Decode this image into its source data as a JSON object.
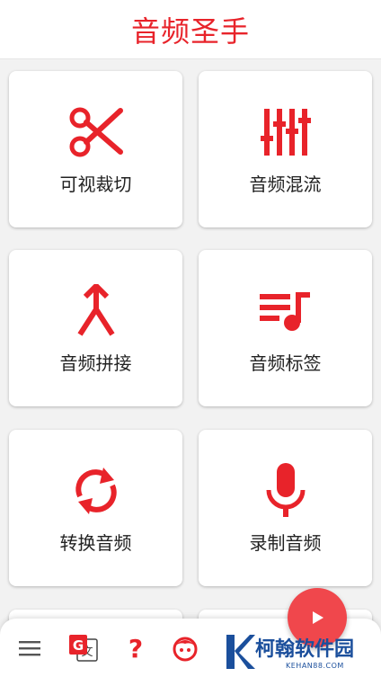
{
  "header": {
    "title": "音频圣手"
  },
  "tools": [
    {
      "label": "可视裁切",
      "icon": "scissors-icon"
    },
    {
      "label": "音频混流",
      "icon": "equalizer-icon"
    },
    {
      "label": "音频拼接",
      "icon": "merge-icon"
    },
    {
      "label": "音频标签",
      "icon": "playlist-music-icon"
    },
    {
      "label": "转换音频",
      "icon": "convert-cycle-icon"
    },
    {
      "label": "录制音频",
      "icon": "microphone-icon"
    }
  ],
  "bottom_nav": [
    {
      "icon": "menu-icon"
    },
    {
      "icon": "translate-icon"
    },
    {
      "icon": "help-icon"
    },
    {
      "icon": "face-icon"
    }
  ],
  "fab": {
    "icon": "play-icon"
  },
  "watermark": {
    "text": "柯翰软件园",
    "sub": "KEHAN88.COM"
  },
  "colors": {
    "accent": "#e8232a",
    "fab": "#f0474c",
    "background": "#f2f2f2",
    "watermark": "#1b4f9c"
  }
}
